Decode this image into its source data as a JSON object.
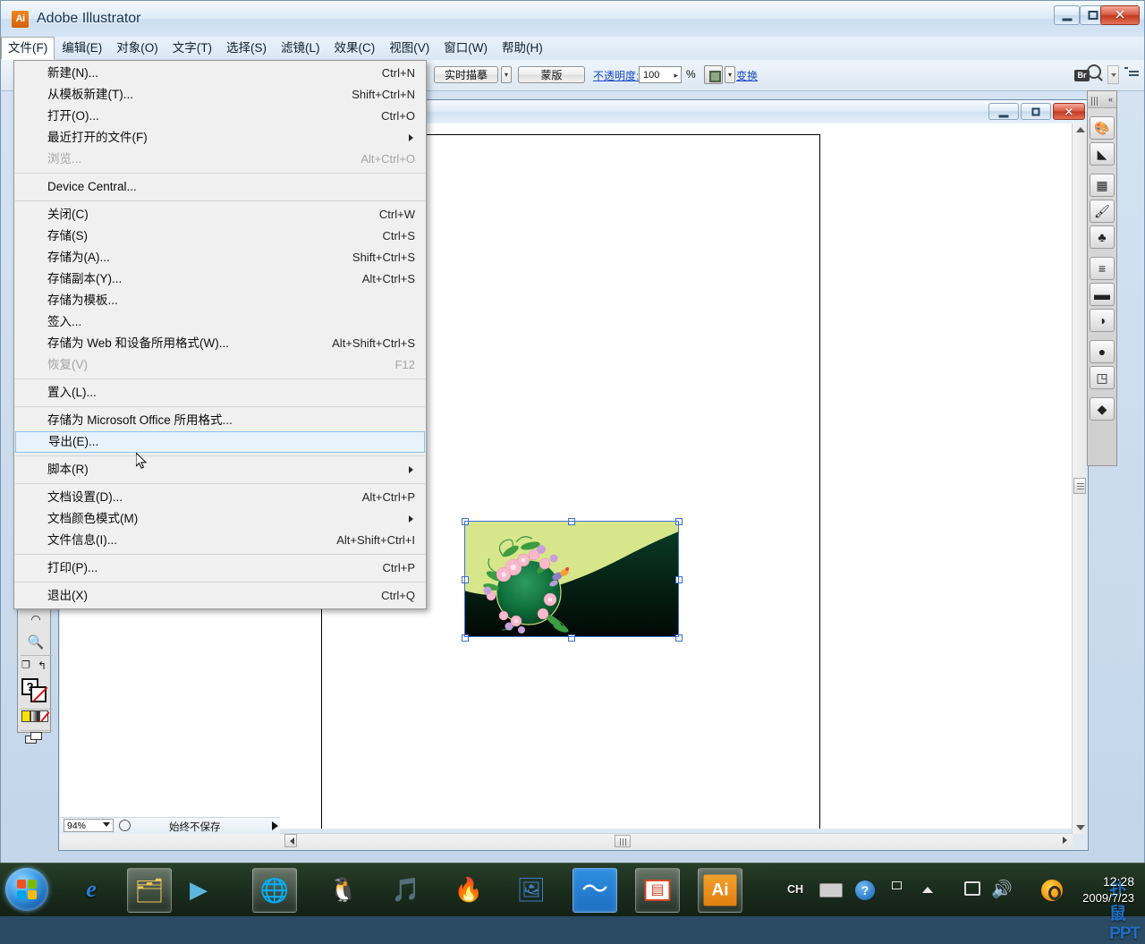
{
  "app": {
    "title": "Adobe Illustrator",
    "logo_text": "Ai"
  },
  "window_controls": {
    "minimize": "minimize-icon",
    "maximize": "maximize-icon",
    "close": "✕"
  },
  "menubar": [
    {
      "label": "文件(F)",
      "open": true
    },
    {
      "label": "编辑(E)",
      "open": false
    },
    {
      "label": "对象(O)",
      "open": false
    },
    {
      "label": "文字(T)",
      "open": false
    },
    {
      "label": "选择(S)",
      "open": false
    },
    {
      "label": "滤镜(L)",
      "open": false
    },
    {
      "label": "效果(C)",
      "open": false
    },
    {
      "label": "视图(V)",
      "open": false
    },
    {
      "label": "窗口(W)",
      "open": false
    },
    {
      "label": "帮助(H)",
      "open": false
    }
  ],
  "file_menu": {
    "items": [
      {
        "label": "新建(N)...",
        "shortcut": "Ctrl+N",
        "disabled": false,
        "submenu": false,
        "highlight": false
      },
      {
        "label": "从模板新建(T)...",
        "shortcut": "Shift+Ctrl+N",
        "disabled": false,
        "submenu": false,
        "highlight": false
      },
      {
        "label": "打开(O)...",
        "shortcut": "Ctrl+O",
        "disabled": false,
        "submenu": false,
        "highlight": false
      },
      {
        "label": "最近打开的文件(F)",
        "shortcut": "",
        "disabled": false,
        "submenu": true,
        "highlight": false
      },
      {
        "label": "浏览...",
        "shortcut": "Alt+Ctrl+O",
        "disabled": true,
        "submenu": false,
        "highlight": false
      },
      {
        "separator": true
      },
      {
        "label": "Device Central...",
        "shortcut": "",
        "disabled": false,
        "submenu": false,
        "highlight": false
      },
      {
        "separator": true
      },
      {
        "label": "关闭(C)",
        "shortcut": "Ctrl+W",
        "disabled": false,
        "submenu": false,
        "highlight": false
      },
      {
        "label": "存储(S)",
        "shortcut": "Ctrl+S",
        "disabled": false,
        "submenu": false,
        "highlight": false
      },
      {
        "label": "存储为(A)...",
        "shortcut": "Shift+Ctrl+S",
        "disabled": false,
        "submenu": false,
        "highlight": false
      },
      {
        "label": "存储副本(Y)...",
        "shortcut": "Alt+Ctrl+S",
        "disabled": false,
        "submenu": false,
        "highlight": false
      },
      {
        "label": "存储为模板...",
        "shortcut": "",
        "disabled": false,
        "submenu": false,
        "highlight": false
      },
      {
        "label": "签入...",
        "shortcut": "",
        "disabled": false,
        "submenu": false,
        "highlight": false
      },
      {
        "label": "存储为 Web 和设备所用格式(W)...",
        "shortcut": "Alt+Shift+Ctrl+S",
        "disabled": false,
        "submenu": false,
        "highlight": false
      },
      {
        "label": "恢复(V)",
        "shortcut": "F12",
        "disabled": true,
        "submenu": false,
        "highlight": false
      },
      {
        "separator": true
      },
      {
        "label": "置入(L)...",
        "shortcut": "",
        "disabled": false,
        "submenu": false,
        "highlight": false
      },
      {
        "separator": true
      },
      {
        "label": "存储为 Microsoft Office 所用格式...",
        "shortcut": "",
        "disabled": false,
        "submenu": false,
        "highlight": false
      },
      {
        "label": "导出(E)...",
        "shortcut": "",
        "disabled": false,
        "submenu": false,
        "highlight": true
      },
      {
        "separator": true
      },
      {
        "label": "脚本(R)",
        "shortcut": "",
        "disabled": false,
        "submenu": true,
        "highlight": false
      },
      {
        "separator": true
      },
      {
        "label": "文档设置(D)...",
        "shortcut": "Alt+Ctrl+P",
        "disabled": false,
        "submenu": false,
        "highlight": false
      },
      {
        "label": "文档颜色模式(M)",
        "shortcut": "",
        "disabled": false,
        "submenu": true,
        "highlight": false
      },
      {
        "label": "文件信息(I)...",
        "shortcut": "Alt+Shift+Ctrl+I",
        "disabled": false,
        "submenu": false,
        "highlight": false
      },
      {
        "separator": true
      },
      {
        "label": "打印(P)...",
        "shortcut": "Ctrl+P",
        "disabled": false,
        "submenu": false,
        "highlight": false
      },
      {
        "separator": true
      },
      {
        "label": "退出(X)",
        "shortcut": "Ctrl+Q",
        "disabled": false,
        "submenu": false,
        "highlight": false
      }
    ]
  },
  "options_bar": {
    "live_trace_label": "实时描摹",
    "mask_label": "蒙版",
    "opacity_label": "不透明度:",
    "opacity_value": "100",
    "percent_sign": "%",
    "transform_label": "变换",
    "bridge_label": "Br",
    "isolate_icon": "isolate-icon",
    "panel_menu_icon": "panel-menu-icon"
  },
  "tool_panel": {
    "tools": [
      {
        "name": "lasso-tool",
        "glyph": "◠"
      },
      {
        "name": "zoom-tool",
        "glyph": "🔍"
      },
      {
        "name": "artboard-tool",
        "glyph": "▣"
      },
      {
        "name": "rotate-view-tool",
        "glyph": "↻"
      },
      {
        "name": "fill-stroke-swatch",
        "glyph": "?"
      },
      {
        "name": "color-gradient-none-row",
        "glyph": "▮"
      },
      {
        "name": "screen-mode-tool",
        "glyph": "❐"
      }
    ]
  },
  "right_dock": {
    "collapse_icon": "collapse-icon",
    "panels": [
      {
        "name": "color-panel",
        "glyph": "🎨"
      },
      {
        "name": "gradient-panel",
        "glyph": "◣"
      },
      {
        "name": "swatches-panel",
        "glyph": "▦"
      },
      {
        "name": "brushes-panel",
        "glyph": "🖌"
      },
      {
        "name": "symbols-panel",
        "glyph": "♣"
      },
      {
        "name": "stroke-panel",
        "glyph": "≡"
      },
      {
        "name": "gradient2-panel",
        "glyph": "▬"
      },
      {
        "name": "transparency-panel",
        "glyph": "◑"
      },
      {
        "name": "appearance-panel",
        "glyph": "●"
      },
      {
        "name": "graphic-styles-panel",
        "glyph": "◳"
      },
      {
        "name": "layers-panel",
        "glyph": "◆"
      }
    ]
  },
  "document": {
    "status_bar": {
      "zoom_level": "94%",
      "status_text": "始终不保存",
      "status_icon": "clock-icon",
      "status_arrow": "status-arrow-icon"
    },
    "artwork_name": "floral-banner-artwork",
    "selection": "selected-object-bounding-box"
  },
  "taskbar": {
    "start_button": "start-orb",
    "items": [
      {
        "name": "internet-explorer",
        "glyph": "e",
        "framed": false,
        "color": "#2a7fd4"
      },
      {
        "name": "file-explorer",
        "glyph": "🗂",
        "framed": true,
        "color": "#f0c45a"
      },
      {
        "name": "media-player",
        "glyph": "▶",
        "framed": false,
        "color": "#5bb7e0"
      },
      {
        "name": "web-browser",
        "glyph": "🌐",
        "framed": true,
        "color": "#7fc4e8"
      },
      {
        "name": "penguin-app",
        "glyph": "🐧",
        "framed": false,
        "color": "#d8d8d8"
      },
      {
        "name": "kugou-music",
        "glyph": "🎵",
        "framed": false,
        "color": "#f59a28"
      },
      {
        "name": "burn-app",
        "glyph": "🔥",
        "framed": false,
        "color": "#e04a2f"
      },
      {
        "name": "photo-app",
        "glyph": "🖼",
        "framed": false,
        "color": "#3f7bc4"
      },
      {
        "name": "kingsoft-app",
        "glyph": "〜",
        "framed": true,
        "color": "#1f7fd6"
      },
      {
        "name": "powerpoint-app",
        "glyph": "▤",
        "framed": true,
        "color": "#d24726"
      },
      {
        "name": "illustrator-app",
        "glyph": "Ai",
        "framed": true,
        "color": "#f09020"
      }
    ],
    "tray": {
      "input_method": "CH",
      "keyboard_icon": "keyboard-icon",
      "help_icon": "help-icon",
      "resize_icon": "resize-icon",
      "show_hidden_icon": "show-hidden-icons",
      "network_icon": "network-icon",
      "volume_icon": "volume-icon",
      "watermark": "扑鼠PPT"
    },
    "clock": {
      "time": "12:28",
      "date": "2009/7/23"
    }
  },
  "colors": {
    "accent": "#1a49c9",
    "highlight": "#e8f2fc",
    "highlight_border": "#8fc0ea",
    "selection": "#3d6fd0",
    "art_light_green": "#d7e68a",
    "art_dark_green": "#063d22",
    "art_black": "#020a05",
    "title_close": "#c23a20"
  }
}
